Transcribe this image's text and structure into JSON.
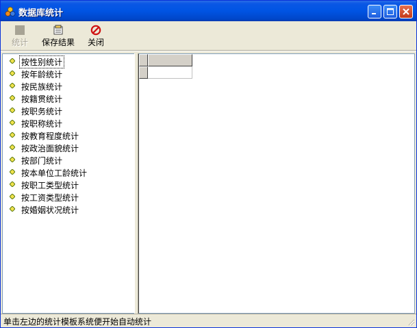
{
  "window": {
    "title": "数据库统计"
  },
  "toolbar": {
    "stats_label": "统计",
    "save_label": "保存结果",
    "close_label": "关闭"
  },
  "tree": {
    "items": [
      {
        "label": "按性别统计"
      },
      {
        "label": "按年龄统计"
      },
      {
        "label": "按民族统计"
      },
      {
        "label": "按籍贯统计"
      },
      {
        "label": "按职务统计"
      },
      {
        "label": "按职称统计"
      },
      {
        "label": "按教育程度统计"
      },
      {
        "label": "按政治面貌统计"
      },
      {
        "label": "按部门统计"
      },
      {
        "label": "按本单位工龄统计"
      },
      {
        "label": "按职工类型统计"
      },
      {
        "label": "按工资类型统计"
      },
      {
        "label": "按婚姻状况统计"
      }
    ]
  },
  "status": {
    "text": "单击左边的统计模板系统便开始自动统计"
  },
  "colors": {
    "title_bar": "#0054E3",
    "window_bg": "#ECE9D8",
    "diamond_fill": "#F2E34C",
    "diamond_stroke": "#5A7A14"
  }
}
